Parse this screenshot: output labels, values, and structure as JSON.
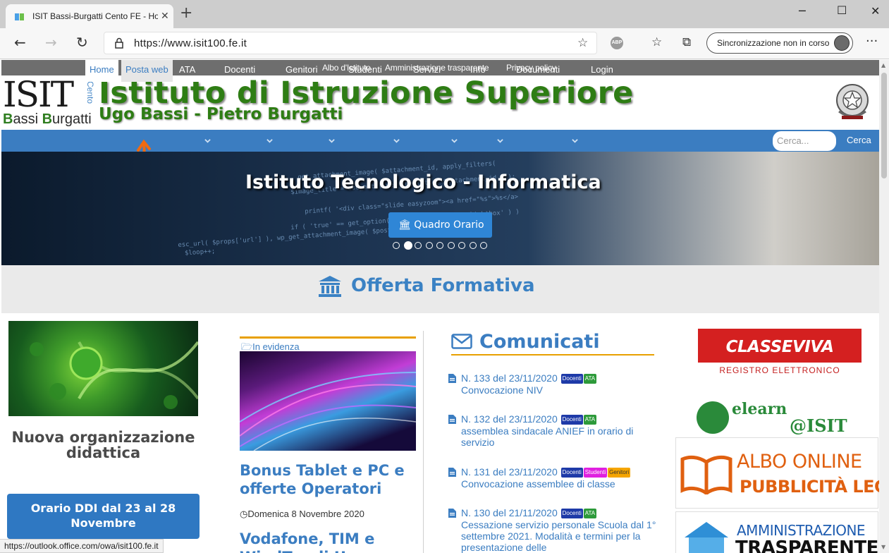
{
  "browser": {
    "tab_title": "ISIT Bassi-Burgatti Cento FE - Ho",
    "url": "https://www.isit100.fe.it",
    "sync_label": "Sincronizzazione non in corso"
  },
  "top_links": [
    "Albo d'Istituto",
    "Amministrazione trasparente",
    "Privacy policy"
  ],
  "header": {
    "logo_main": "ISIT",
    "logo_vertical": "Cento",
    "logo_first": "Bassi",
    "logo_second": "Burgatti",
    "title": "Istituto di Istruzione Superiore",
    "subtitle": "Ugo Bassi - Pietro Burgatti"
  },
  "nav": {
    "items": [
      "Home",
      "Posta web",
      "ATA",
      "Docenti",
      "Genitori",
      "Studenti",
      "Servizi",
      "Info",
      "Documenti",
      "Login"
    ],
    "search_placeholder": "Cerca...",
    "search_button": "Cerca"
  },
  "hero": {
    "title": "Istituto Tecnologico - Informatica",
    "button": "Quadro Orario",
    "slide_count": 9,
    "active_slide": 2
  },
  "offerta": {
    "title": "Offerta Formativa"
  },
  "left_card": {
    "title": "Nuova organizzazione didattica",
    "button": "Orario DDI dal 23 al 28 Novembre"
  },
  "evidenza": {
    "label": "In evidenza",
    "article1_title": "Bonus Tablet e PC e offerte Operatori",
    "article1_date": "Domenica 8  Novembre 2020",
    "article2_title": "Vodafone, TIM e WindTre di U"
  },
  "comunicati": {
    "title": "Comunicati",
    "items": [
      {
        "head": "N. 133 del 23/11/2020",
        "badges": [
          "Docenti",
          "ATA"
        ],
        "body": "Convocazione NIV"
      },
      {
        "head": "N. 132 del 23/11/2020",
        "badges": [
          "Docenti",
          "ATA"
        ],
        "body": "assemblea sindacale ANIEF in orario di servizio"
      },
      {
        "head": "N. 131 del 23/11/2020",
        "badges": [
          "Docenti",
          "Studenti",
          "Genitori"
        ],
        "body": "Convocazione assemblee di classe"
      },
      {
        "head": "N. 130 del 21/11/2020",
        "badges": [
          "Docenti",
          "ATA"
        ],
        "body": "Cessazione servizio personale Scuola dal 1° settembre 2021.  Modalità e termini per la presentazione delle"
      }
    ]
  },
  "sidebar": {
    "classeviva_title": "CLASSEVIVA",
    "classeviva_sub": "REGISTRO  ELETTRONICO",
    "elearn_1": "elearn",
    "elearn_2": "@ISIT",
    "albo_1": "ALBO ONLINE",
    "albo_2": "PUBBLICITÀ LEGALE",
    "amm_1": "AMMINISTRAZIONE",
    "amm_2": "TRASPARENTE"
  },
  "status_url": "https://outlook.office.com/owa/isit100.fe.it",
  "colors": {
    "nav_blue": "#3b7dc1",
    "title_green": "#2e7d14",
    "accent_orange": "#e8a000"
  }
}
